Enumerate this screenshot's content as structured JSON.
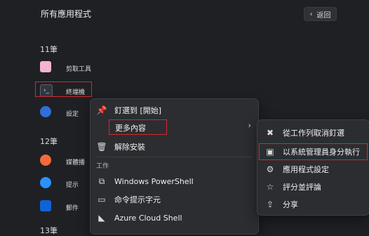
{
  "start_menu": {
    "title": "所有應用程式",
    "back_label": "返回",
    "sections": [
      {
        "header": "11筆"
      },
      {
        "header": "12筆"
      },
      {
        "header": "13筆"
      }
    ],
    "apps": [
      {
        "label": "剪取工具",
        "icon": "snipping-tool-icon",
        "color": "#f3b3d2"
      },
      {
        "label": "終端機",
        "icon": "terminal-icon",
        "color": "#2f3640"
      },
      {
        "label": "設定",
        "icon": "settings-icon",
        "color": "#2f6fda"
      },
      {
        "label": "媒體播",
        "icon": "media-player-icon",
        "color": "#f56a3b"
      },
      {
        "label": "提示",
        "icon": "tips-icon",
        "color": "#2a92ff"
      },
      {
        "label": "郵件",
        "icon": "mail-icon",
        "color": "#0f63d6"
      }
    ]
  },
  "context_menu": {
    "items": [
      {
        "label": "釘選到 [開始]",
        "icon": "pin-icon"
      },
      {
        "label": "更多內容",
        "icon": "more-content",
        "chevron": "›"
      },
      {
        "label": "解除安裝",
        "icon": "trash-icon"
      }
    ],
    "section_label": "工作",
    "tasks": [
      {
        "label": "Windows PowerShell",
        "icon": "powershell-icon"
      },
      {
        "label": "命令提示字元",
        "icon": "cmd-icon"
      },
      {
        "label": "Azure Cloud Shell",
        "icon": "azure-icon"
      }
    ]
  },
  "submenu": {
    "items": [
      {
        "label": "從工作列取消釘選",
        "icon": "unpin-icon"
      },
      {
        "label": "以系統管理員身分執行",
        "icon": "admin-icon"
      },
      {
        "label": "應用程式設定",
        "icon": "gear-icon"
      },
      {
        "label": "評分並評論",
        "icon": "rating-icon"
      },
      {
        "label": "分享",
        "icon": "share-icon"
      }
    ]
  }
}
